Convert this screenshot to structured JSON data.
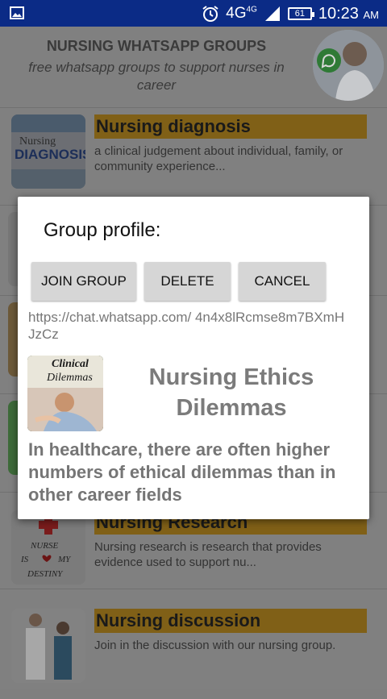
{
  "status_bar": {
    "network": "4G",
    "network_sup": "4G",
    "battery": "61",
    "time": "10:23",
    "ampm": "AM",
    "icons": [
      "image-icon",
      "alarm-icon",
      "signal-icon",
      "battery-icon"
    ]
  },
  "header": {
    "title": "NURSING WHATSAPP GROUPS",
    "subtitle": "free whatsapp groups to support nurses in career"
  },
  "groups": [
    {
      "title": "Nursing diagnosis",
      "desc": "a clinical judgement about individual, family, or community experience...",
      "thumb_text_1": "Nursing",
      "thumb_text_2": "DIAGNOSIS"
    },
    {
      "title": "Nursing Research",
      "desc": "Nursing research is research that provides evidence used to support nu...",
      "thumb_text_1": "NURSE",
      "thumb_text_2": "IS",
      "thumb_text_3": "MY",
      "thumb_text_4": "DESTINY"
    },
    {
      "title": "Nursing discussion",
      "desc": "Join in the discussion with our nursing group."
    }
  ],
  "dialog": {
    "title": "Group profile:",
    "join_label": "JOIN GROUP",
    "delete_label": "DELETE",
    "cancel_label": "CANCEL",
    "url": "https://chat.whatsapp.com/ 4n4x8lRcmse8m7BXmHJzCz",
    "thumb_text_1": "Clinical",
    "thumb_text_2": "Dilemmas",
    "group_name": "Nursing Ethics Dilemmas",
    "group_desc": "In healthcare, there are often higher numbers of ethical dilemmas than in other career fields"
  },
  "colors": {
    "status_bar": "#0b2b86",
    "title_highlight": "#806017",
    "button": "#d6d6d6"
  }
}
